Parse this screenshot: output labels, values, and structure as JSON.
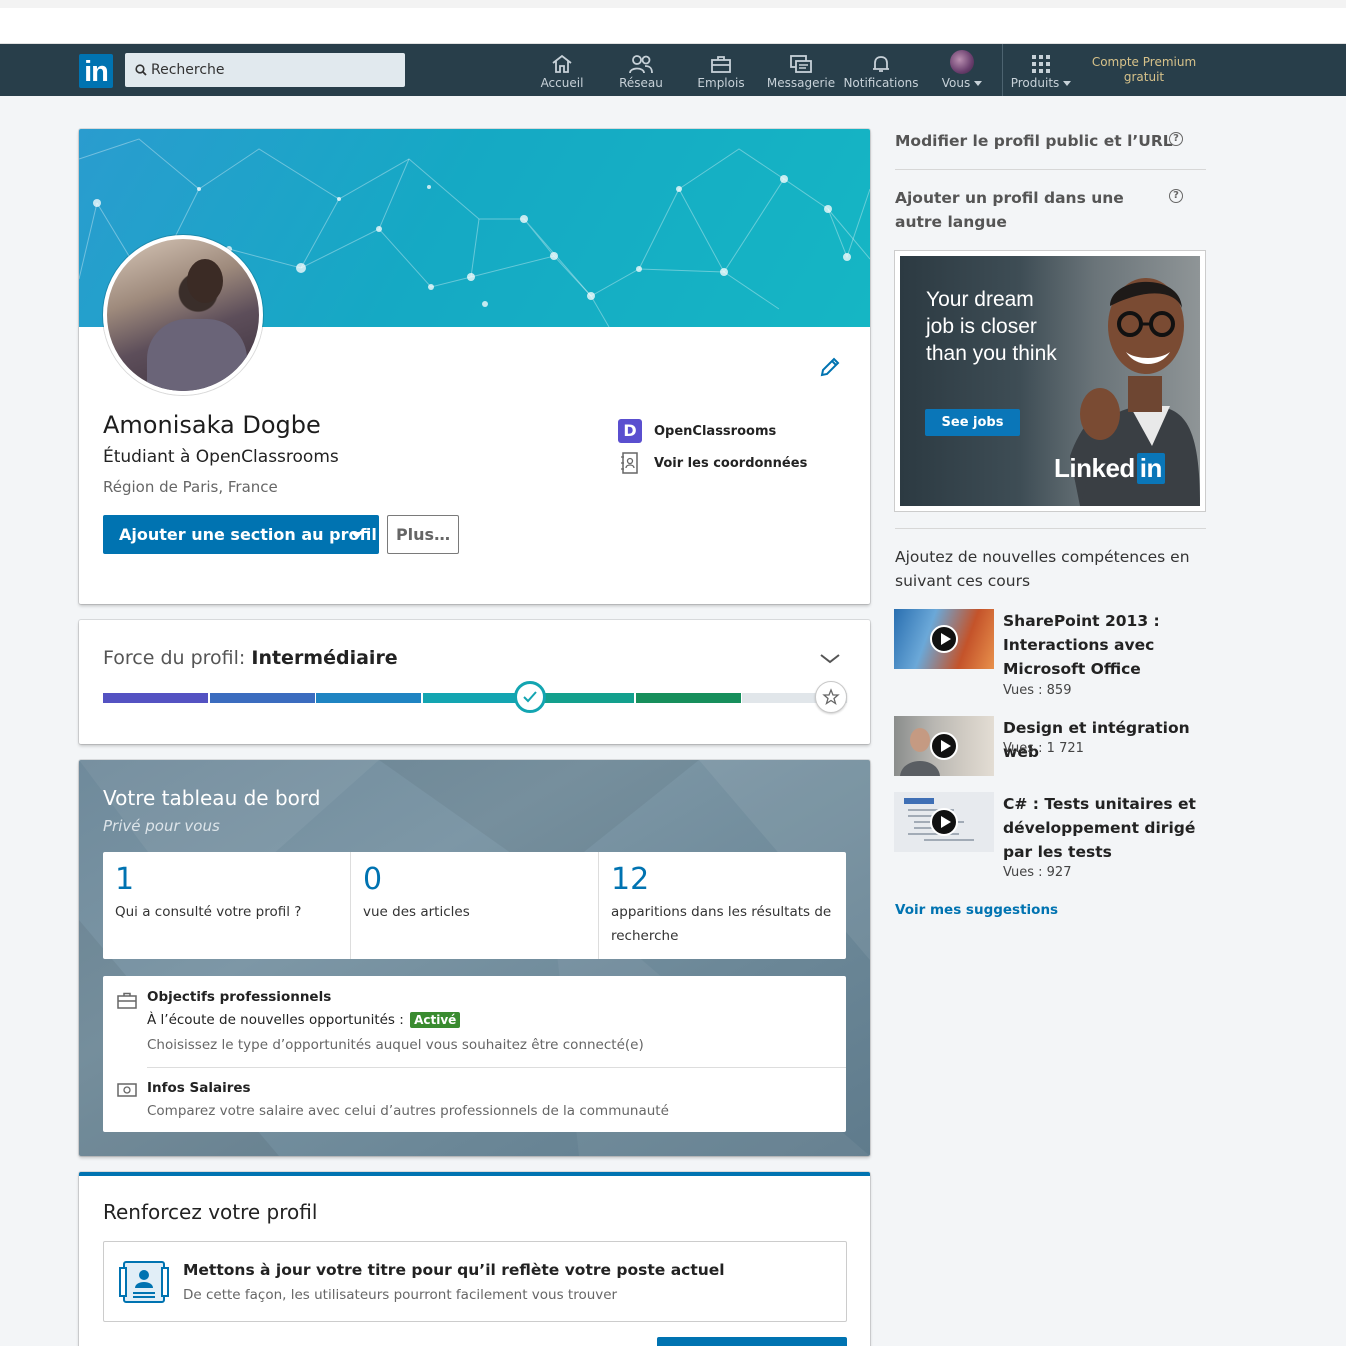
{
  "nav": {
    "search_placeholder": "Recherche",
    "items": [
      {
        "label": "Accueil",
        "icon": "home-icon"
      },
      {
        "label": "Réseau",
        "icon": "network-icon"
      },
      {
        "label": "Emplois",
        "icon": "briefcase-icon"
      },
      {
        "label": "Messagerie",
        "icon": "messaging-icon"
      },
      {
        "label": "Notifications",
        "icon": "bell-icon"
      },
      {
        "label": "Vous",
        "icon": "avatar"
      },
      {
        "label": "Produits",
        "icon": "grid-icon"
      }
    ],
    "premium_line1": "Compte Premium",
    "premium_line2": "gratuit"
  },
  "profile": {
    "name": "Amonisaka Dogbe",
    "headline": "Étudiant à OpenClassrooms",
    "location": "Région de Paris, France",
    "company": "OpenClassrooms",
    "contact": "Voir les coordonnées",
    "add_section": "Ajouter une section au profil",
    "more": "Plus…"
  },
  "strength": {
    "label": "Force du profil:",
    "level": "Intermédiaire",
    "level_index": 4,
    "levels_total": 7,
    "colors": [
      "#5452c2",
      "#3b6cbf",
      "#1f84c2",
      "#13a5b1",
      "#13a08d",
      "#178f5c",
      "#e1e6ea"
    ]
  },
  "dashboard": {
    "title": "Votre tableau de bord",
    "subtitle": "Privé pour vous",
    "stats": [
      {
        "value": "1",
        "label": "Qui a consulté votre profil ?"
      },
      {
        "value": "0",
        "label": "vue des articles"
      },
      {
        "value": "12",
        "label": "apparitions dans les résultats de recherche"
      }
    ],
    "goals": {
      "title": "Objectifs professionnels",
      "line": "À l’écoute de nouvelles opportunités :",
      "badge": "Activé",
      "sub": "Choisissez le type d’opportunités auquel vous souhaitez être connecté(e)"
    },
    "salary": {
      "title": "Infos Salaires",
      "sub": "Comparez votre salaire avec celui d’autres professionnels de la communauté"
    }
  },
  "strengthen": {
    "title": "Renforcez votre profil",
    "card_title": "Mettons à jour votre titre pour qu’il reflète votre poste actuel",
    "card_sub": "De cette façon, les utilisateurs pourront facilement vous trouver"
  },
  "rail": {
    "link1": "Modifier le profil public et l’URL",
    "link2": "Ajouter un profil dans une autre langue",
    "ad_text": "Your dream job is closer than you think",
    "ad_button": "See jobs",
    "ad_brand": "Linked",
    "ad_brand_in": "in",
    "learning_title": "Ajoutez de nouvelles compétences en suivant ces cours",
    "courses": [
      {
        "title": "SharePoint 2013 : Interactions avec Microsoft Office",
        "views": "Vues : 859"
      },
      {
        "title": "Design et intégration web",
        "views": "Vues : 1 721"
      },
      {
        "title": "C# : Tests unitaires et développement dirigé par les tests",
        "views": "Vues : 927"
      }
    ],
    "suggestions": "Voir mes suggestions"
  }
}
